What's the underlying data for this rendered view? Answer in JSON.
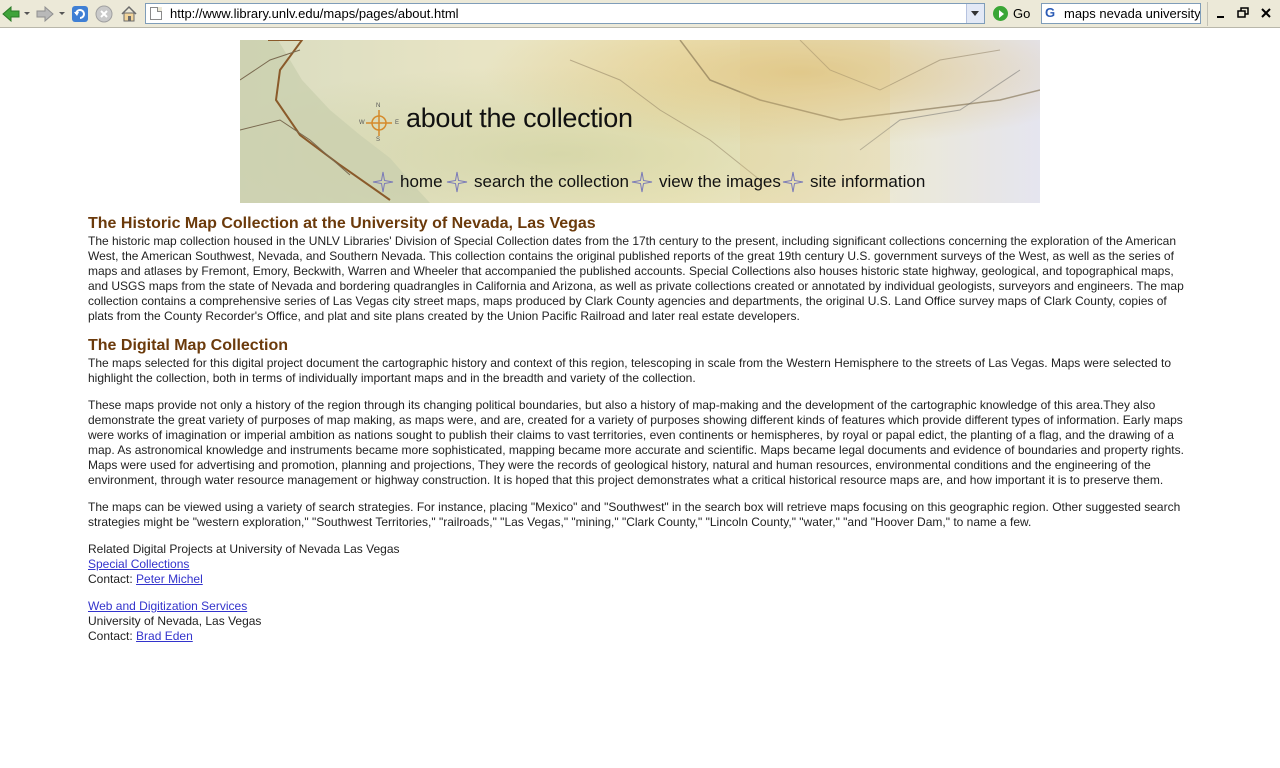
{
  "browser": {
    "url": "http://www.library.unlv.edu/maps/pages/about.html",
    "go_label": "Go",
    "search_value": "maps nevada university"
  },
  "banner": {
    "title": "about the collection",
    "compass": [
      "N",
      "W",
      "E",
      "S"
    ],
    "nav": [
      "home",
      "search the collection",
      "view the images",
      "site information"
    ]
  },
  "section1": {
    "heading": "The Historic Map Collection at the University of Nevada, Las Vegas",
    "body": "The historic map collection housed in the UNLV Libraries' Division of Special Collection dates from the 17th century to the present, including significant collections concerning the exploration of the American West, the American Southwest, Nevada, and Southern Nevada. This collection contains the original published reports of the great 19th century U.S. government surveys of the West, as well as the series of maps and atlases by Fremont, Emory, Beckwith, Warren and Wheeler that accompanied the published accounts. Special Collections also houses historic state highway, geological, and topographical maps, and USGS maps from the state of Nevada and bordering quadrangles in California and Arizona, as well as private collections created or annotated by individual geologists, surveyors and engineers. The map collection contains a comprehensive series of Las Vegas city street maps, maps produced by Clark County agencies and departments, the original U.S. Land Office survey maps of Clark County, copies of plats from the County Recorder's Office, and plat and site plans created by the Union Pacific Railroad and later real estate developers."
  },
  "section2": {
    "heading": "The Digital Map Collection",
    "paragraphs": [
      "The maps selected for this digital project document the cartographic history and context of this region, telescoping in scale from the Western Hemisphere to the streets of Las Vegas. Maps were selected to highlight the collection, both in terms of individually important maps and in the breadth and variety of the collection.",
      "These maps provide not only a history of the region through its changing political boundaries, but also a history of map-making and the development of the cartographic knowledge of this area.They also demonstrate the great variety of purposes of map making, as maps were, and are, created for a variety of purposes showing different kinds of features which provide different types of information. Early maps were works of imagination or imperial ambition as nations sought to publish their claims to vast territories, even continents or hemispheres, by royal or papal edict, the planting of a flag, and the drawing of a map. As astronomical knowledge and instruments became more sophisticated, mapping became more accurate and scientific. Maps became legal documents and evidence of boundaries and property rights. Maps were used for advertising and promotion, planning and projections, They were the records of geological history, natural and human resources, environmental conditions and the engineering of the environment, through water resource management or highway construction. It is hoped that this project demonstrates what a critical historical resource maps are, and how important it is to preserve them.",
      "The maps can be viewed using a variety of search strategies. For instance, placing \"Mexico\" and \"Southwest\" in the search box will retrieve maps focusing on this geographic region. Other suggested search strategies might be \"western exploration,\" \"Southwest Territories,\" \"railroads,\" \"Las Vegas,\" \"mining,\" \"Clark County,\" \"Lincoln County,\" \"water,\" \"and \"Hoover Dam,\" to name a few."
    ]
  },
  "related": {
    "heading": "Related Digital Projects at University of Nevada Las Vegas",
    "link1": "Special Collections",
    "contact_label": "Contact:",
    "contact1": "Peter Michel",
    "link2": "Web and Digitization Services",
    "org2": "University of Nevada, Las Vegas",
    "contact2": "Brad Eden"
  },
  "colors": {
    "heading": "#6b3a0b",
    "link": "#3333cc",
    "toolbar": "#ece9d8"
  }
}
